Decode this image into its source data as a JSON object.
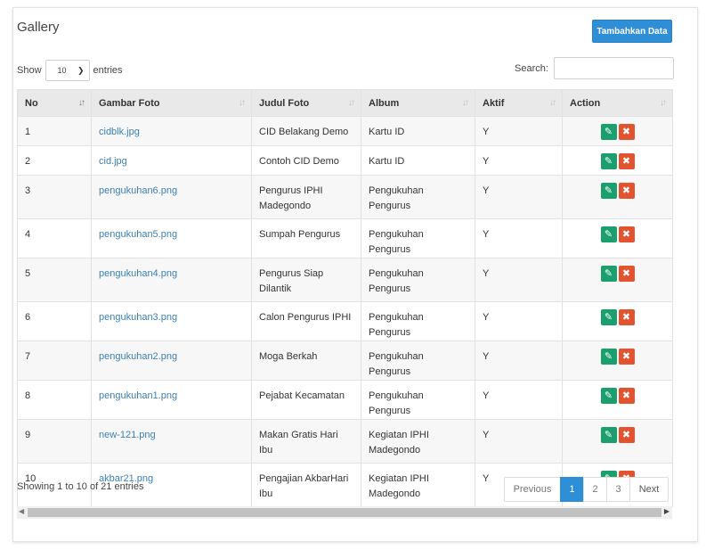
{
  "header": {
    "title": "Gallery",
    "add_button": "Tambahkan Data"
  },
  "controls": {
    "show_label": "Show",
    "length_value": "10",
    "entries_label": "entries",
    "search_label": "Search:",
    "search_value": ""
  },
  "table": {
    "columns": [
      "No",
      "Gambar Foto",
      "Judul Foto",
      "Album",
      "Aktif",
      "Action"
    ],
    "rows": [
      {
        "no": "1",
        "image": "cidblk.jpg",
        "title": "CID Belakang Demo",
        "album": "Kartu ID",
        "active": "Y"
      },
      {
        "no": "2",
        "image": "cid.jpg",
        "title": "Contoh CID Demo",
        "album": "Kartu ID",
        "active": "Y"
      },
      {
        "no": "3",
        "image": "pengukuhan6.png",
        "title": "Pengurus IPHI Madegondo",
        "album": "Pengukuhan Pengurus",
        "active": "Y"
      },
      {
        "no": "4",
        "image": "pengukuhan5.png",
        "title": "Sumpah Pengurus",
        "album": "Pengukuhan Pengurus",
        "active": "Y"
      },
      {
        "no": "5",
        "image": "pengukuhan4.png",
        "title": "Pengurus Siap Dilantik",
        "album": "Pengukuhan Pengurus",
        "active": "Y"
      },
      {
        "no": "6",
        "image": "pengukuhan3.png",
        "title": "Calon Pengurus IPHI",
        "album": "Pengukuhan Pengurus",
        "active": "Y"
      },
      {
        "no": "7",
        "image": "pengukuhan2.png",
        "title": "Moga Berkah",
        "album": "Pengukuhan Pengurus",
        "active": "Y"
      },
      {
        "no": "8",
        "image": "pengukuhan1.png",
        "title": "Pejabat Kecamatan",
        "album": "Pengukuhan Pengurus",
        "active": "Y"
      },
      {
        "no": "9",
        "image": "new-121.png",
        "title": "Makan Gratis Hari Ibu",
        "album": "Kegiatan IPHI Madegondo",
        "active": "Y"
      },
      {
        "no": "10",
        "image": "akbar21.png",
        "title": "Pengajian AkbarHari Ibu",
        "album": "Kegiatan IPHI Madegondo",
        "active": "Y"
      }
    ],
    "row_heights": [
      33,
      33,
      49,
      33,
      49,
      33,
      33,
      33,
      49,
      49
    ]
  },
  "footer": {
    "info": "Showing 1 to 10 of 21 entries",
    "pagination": {
      "previous": "Previous",
      "pages": [
        "1",
        "2",
        "3"
      ],
      "current": "1",
      "next": "Next"
    }
  },
  "icons": {
    "sort": "sort-arrows-icon",
    "edit": "edit-icon",
    "delete": "delete-x-icon",
    "scroll_left": "scroll-left-arrow-icon",
    "scroll_right": "scroll-right-arrow-icon"
  },
  "colors": {
    "primary": "#2f8fd6",
    "edit": "#1b9f6f",
    "delete": "#e2542f",
    "link": "#3a80b5",
    "header_bg": "#e9e9e9"
  }
}
